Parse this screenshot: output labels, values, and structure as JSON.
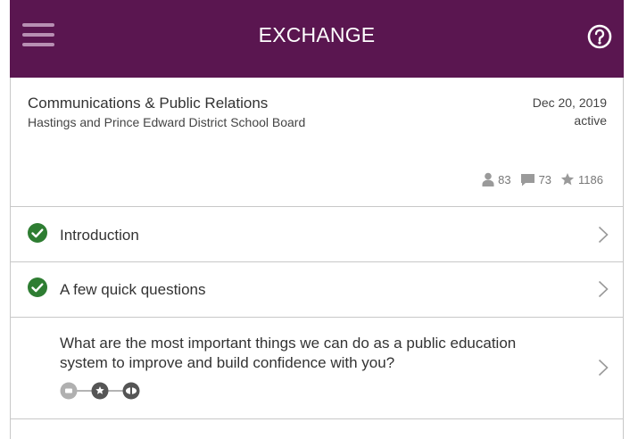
{
  "header": {
    "title": "EXCHANGE"
  },
  "info": {
    "title": "Communications & Public Relations",
    "organization": "Hastings and Prince Edward District School Board",
    "date": "Dec 20, 2019",
    "status": "active",
    "stats": {
      "participants": "83",
      "comments": "73",
      "stars": "1186"
    }
  },
  "sections": [
    {
      "label": "Introduction",
      "completed": true
    },
    {
      "label": "A few quick questions",
      "completed": true
    },
    {
      "label": "What are the most important things we can do as a public education system to improve and build confidence with you?",
      "completed": false,
      "steps": [
        "comment-step-icon",
        "star-step-icon",
        "view-step-icon"
      ]
    }
  ],
  "colors": {
    "header": "#5a1650",
    "check": "#2e7d32",
    "accent_light": "#b88fb3"
  }
}
